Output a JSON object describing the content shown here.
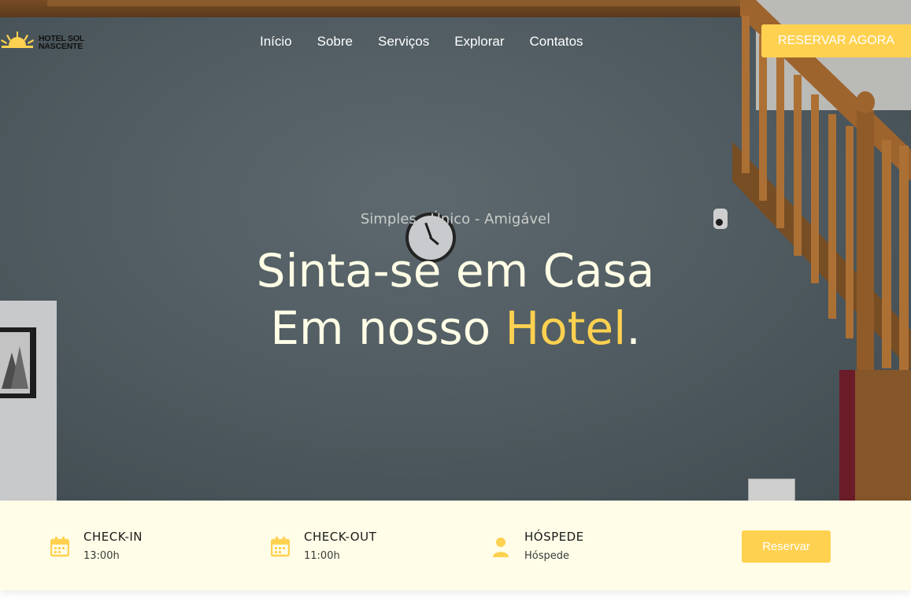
{
  "brand": {
    "logo_line1": "HOTEL SOL",
    "logo_line2": "NASCENTE",
    "logo_icon": "sun-icon",
    "accent_color": "#ffd150"
  },
  "nav": {
    "items": [
      {
        "label": "Início"
      },
      {
        "label": "Sobre"
      },
      {
        "label": "Serviços"
      },
      {
        "label": "Explorar"
      },
      {
        "label": "Contatos"
      }
    ],
    "cta_label": "RESERVAR AGORA"
  },
  "hero": {
    "tagline": "Simples - Único - Amigável",
    "headline_line1": "Sinta-se em Casa",
    "headline_line2_prefix": "Em nosso ",
    "headline_highlight": "Hotel",
    "headline_suffix": "."
  },
  "booking": {
    "items": [
      {
        "icon": "calendar-icon",
        "title": "CHECK-IN",
        "value": "13:00h"
      },
      {
        "icon": "calendar-icon",
        "title": "CHECK-OUT",
        "value": "11:00h"
      },
      {
        "icon": "user-icon",
        "title": "HÓSPEDE",
        "value": "Hóspede"
      }
    ],
    "button_label": "Reservar"
  }
}
